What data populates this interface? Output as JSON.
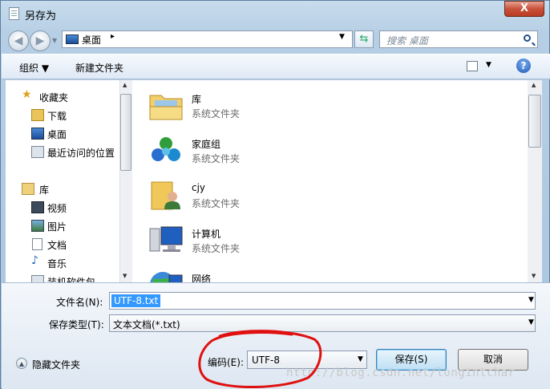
{
  "window": {
    "title": "另存为",
    "close_glyph": "X"
  },
  "address": {
    "location": "桌面",
    "separator": "▸"
  },
  "search": {
    "placeholder": "搜索 桌面"
  },
  "toolbar": {
    "organize": "组织 ▼",
    "new_folder": "新建文件夹",
    "help": "?"
  },
  "nav_pane": {
    "items": [
      {
        "label": "收藏夹"
      },
      {
        "label": "下载"
      },
      {
        "label": "桌面"
      },
      {
        "label": "最近访问的位置"
      },
      {
        "label": "库"
      },
      {
        "label": "视频"
      },
      {
        "label": "图片"
      },
      {
        "label": "文档"
      },
      {
        "label": "音乐"
      },
      {
        "label": "装机软件包"
      }
    ]
  },
  "files": [
    {
      "name": "库",
      "type": "系统文件夹"
    },
    {
      "name": "家庭组",
      "type": "系统文件夹"
    },
    {
      "name": "cjy",
      "type": "系统文件夹"
    },
    {
      "name": "计算机",
      "type": "系统文件夹"
    },
    {
      "name": "网络",
      "type": ""
    }
  ],
  "form": {
    "filename_label": "文件名(N):",
    "filename_value": "UTF-8.txt",
    "filetype_label": "保存类型(T):",
    "filetype_value": "文本文档(*.txt)",
    "hide_folders": "隐藏文件夹",
    "encoding_label": "编码(E):",
    "encoding_value": "UTF-8",
    "save": "保存(S)",
    "cancel": "取消"
  },
  "watermark": "http://blog.csdn.net/longintchar",
  "colors": {
    "accent": "#3399ff",
    "annotation": "#e01010"
  }
}
